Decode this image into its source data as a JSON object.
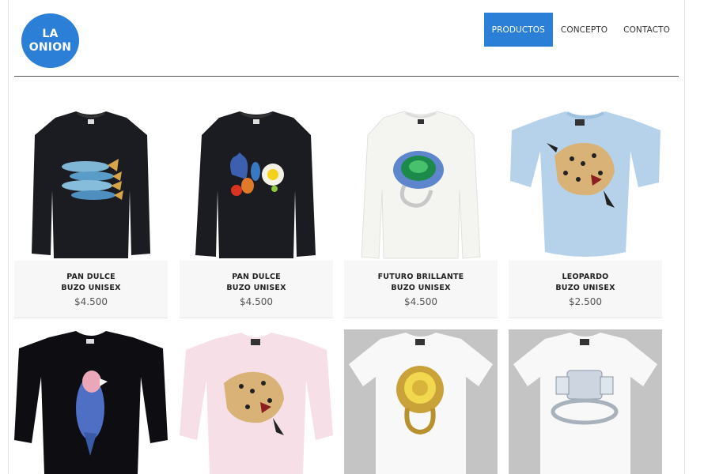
{
  "brand": {
    "logo_line1": "LA",
    "logo_line2": "ONION",
    "color": "#2b7fd6"
  },
  "nav": {
    "items": [
      {
        "label": "PRODUCTOS",
        "active": true
      },
      {
        "label": "CONCEPTO",
        "active": false
      },
      {
        "label": "CONTACTO",
        "active": false
      }
    ]
  },
  "products": [
    {
      "name": "PAN DULCE",
      "type": "BUZO UNISEX",
      "price": "$4.500",
      "graphic": "fish-icon"
    },
    {
      "name": "PAN DULCE",
      "type": "BUZO UNISEX",
      "price": "$4.500",
      "graphic": "still-life-icon"
    },
    {
      "name": "FUTURO BRILLANTE",
      "type": "BUZO UNISEX",
      "price": "$4.500",
      "graphic": "emerald-ring-icon"
    },
    {
      "name": "LEOPARDO",
      "type": "BUZO UNISEX",
      "price": "$2.500",
      "graphic": "leopard-icon"
    },
    {
      "graphic": "parrot-icon"
    },
    {
      "graphic": "leopard-icon"
    },
    {
      "graphic": "gold-ring-icon"
    },
    {
      "graphic": "diamond-ring-icon"
    }
  ]
}
